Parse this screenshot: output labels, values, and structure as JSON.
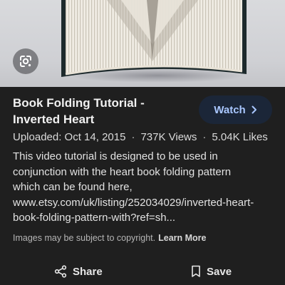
{
  "preview": {
    "lens_icon": "google-lens-icon"
  },
  "title": "Book Folding Tutorial - Inverted Heart",
  "watch": {
    "label": "Watch",
    "icon": "chevron-right-icon"
  },
  "meta": {
    "uploaded": "Uploaded: Oct 14, 2015",
    "views": "737K Views",
    "likes": "5.04K Likes",
    "separator": "·"
  },
  "description": {
    "lines": [
      "This video tutorial is designed to be used in",
      "conjunction with the heart book folding pattern",
      "which can be found here,",
      "www.etsy.com/uk/listing/252034029/inverted-heart-",
      "book-folding-pattern-with?ref=sh..."
    ]
  },
  "copyright": {
    "text": "Images may be subject to copyright.",
    "link": "Learn More"
  },
  "actions": {
    "share": {
      "label": "Share",
      "icon": "share-icon"
    },
    "save": {
      "label": "Save",
      "icon": "bookmark-icon"
    }
  },
  "colors": {
    "background": "#1f1f1f",
    "watch_bg": "#1b2638",
    "watch_text": "#a9c7ff"
  }
}
